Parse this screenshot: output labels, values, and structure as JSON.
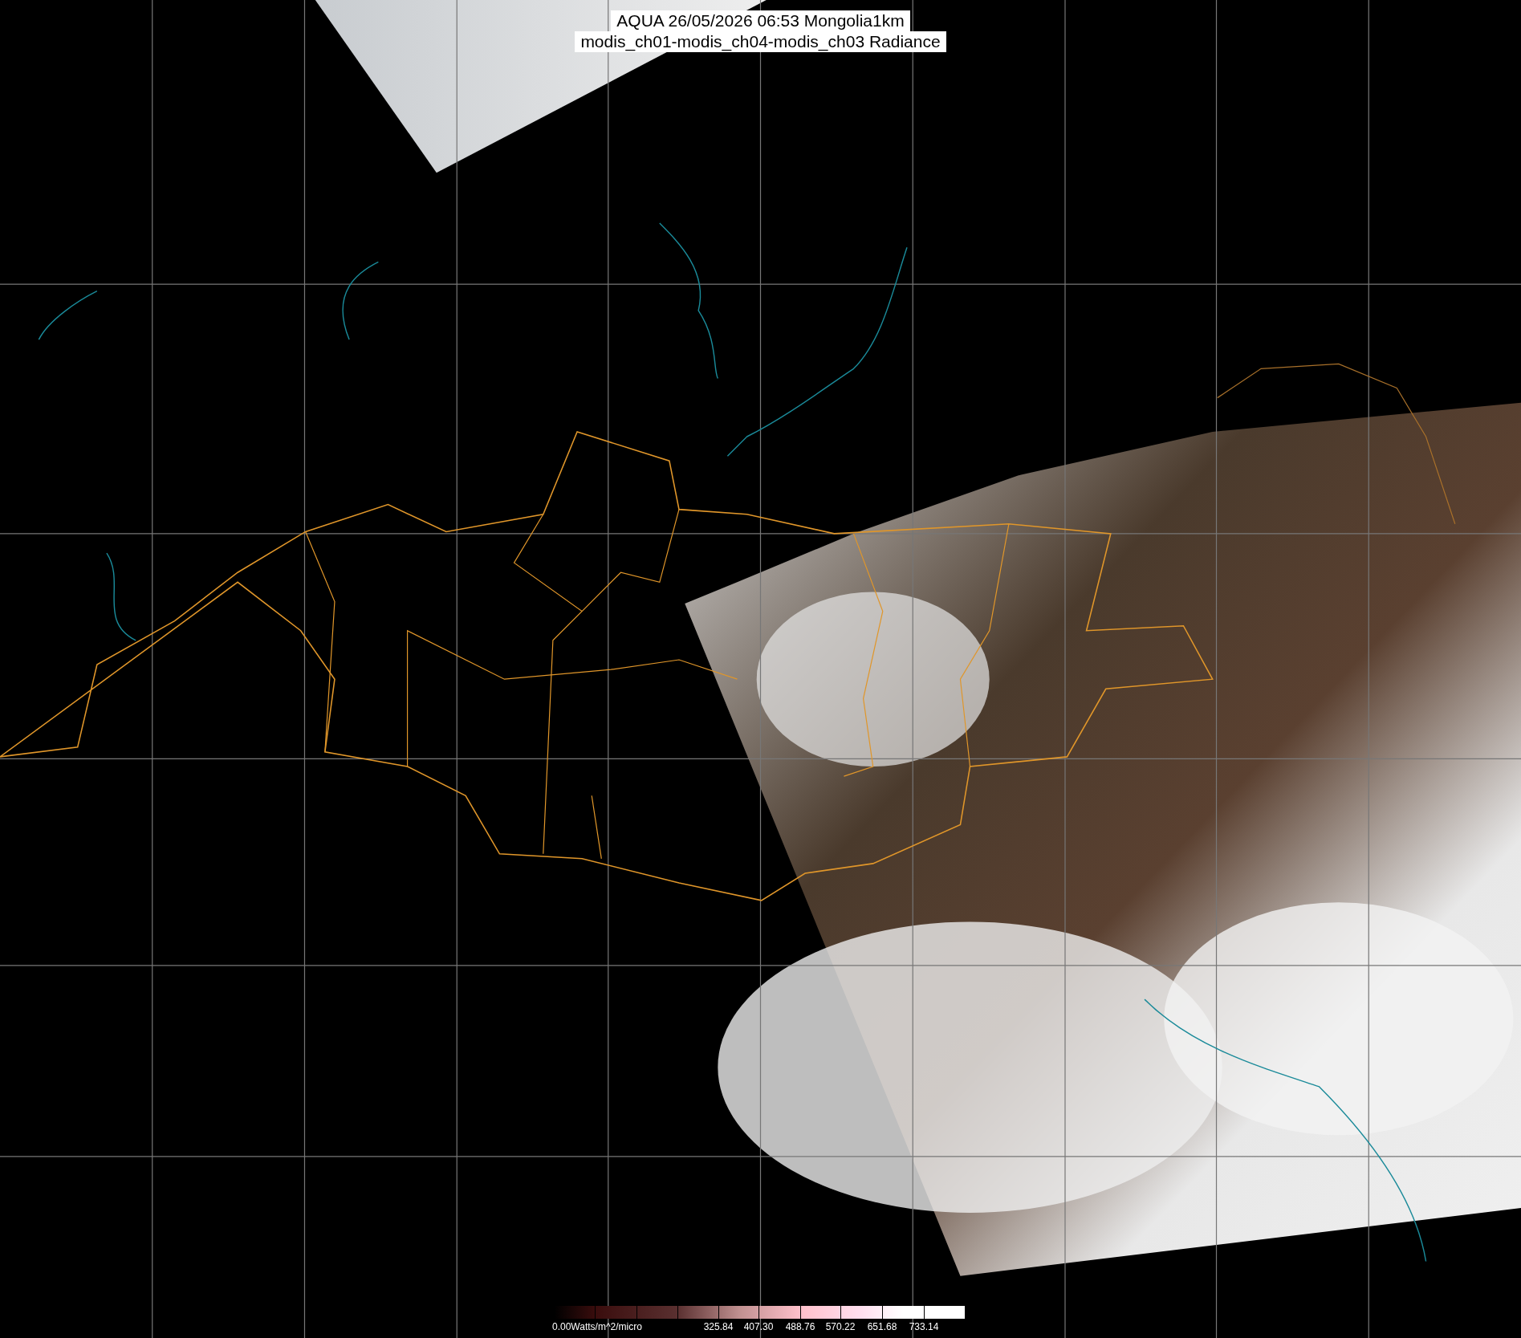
{
  "title": {
    "lines": [
      "AQUA 26/05/2026 06:53 Mongolia1km",
      "modis_ch01-modis_ch04-modis_ch03 Radiance"
    ]
  },
  "color_bar": {
    "unit_label": "0.00Watts/m^2/micro",
    "tick_labels": [
      "325.84",
      "407.30",
      "488.76",
      "570.22",
      "651.68",
      "733.14"
    ]
  }
}
